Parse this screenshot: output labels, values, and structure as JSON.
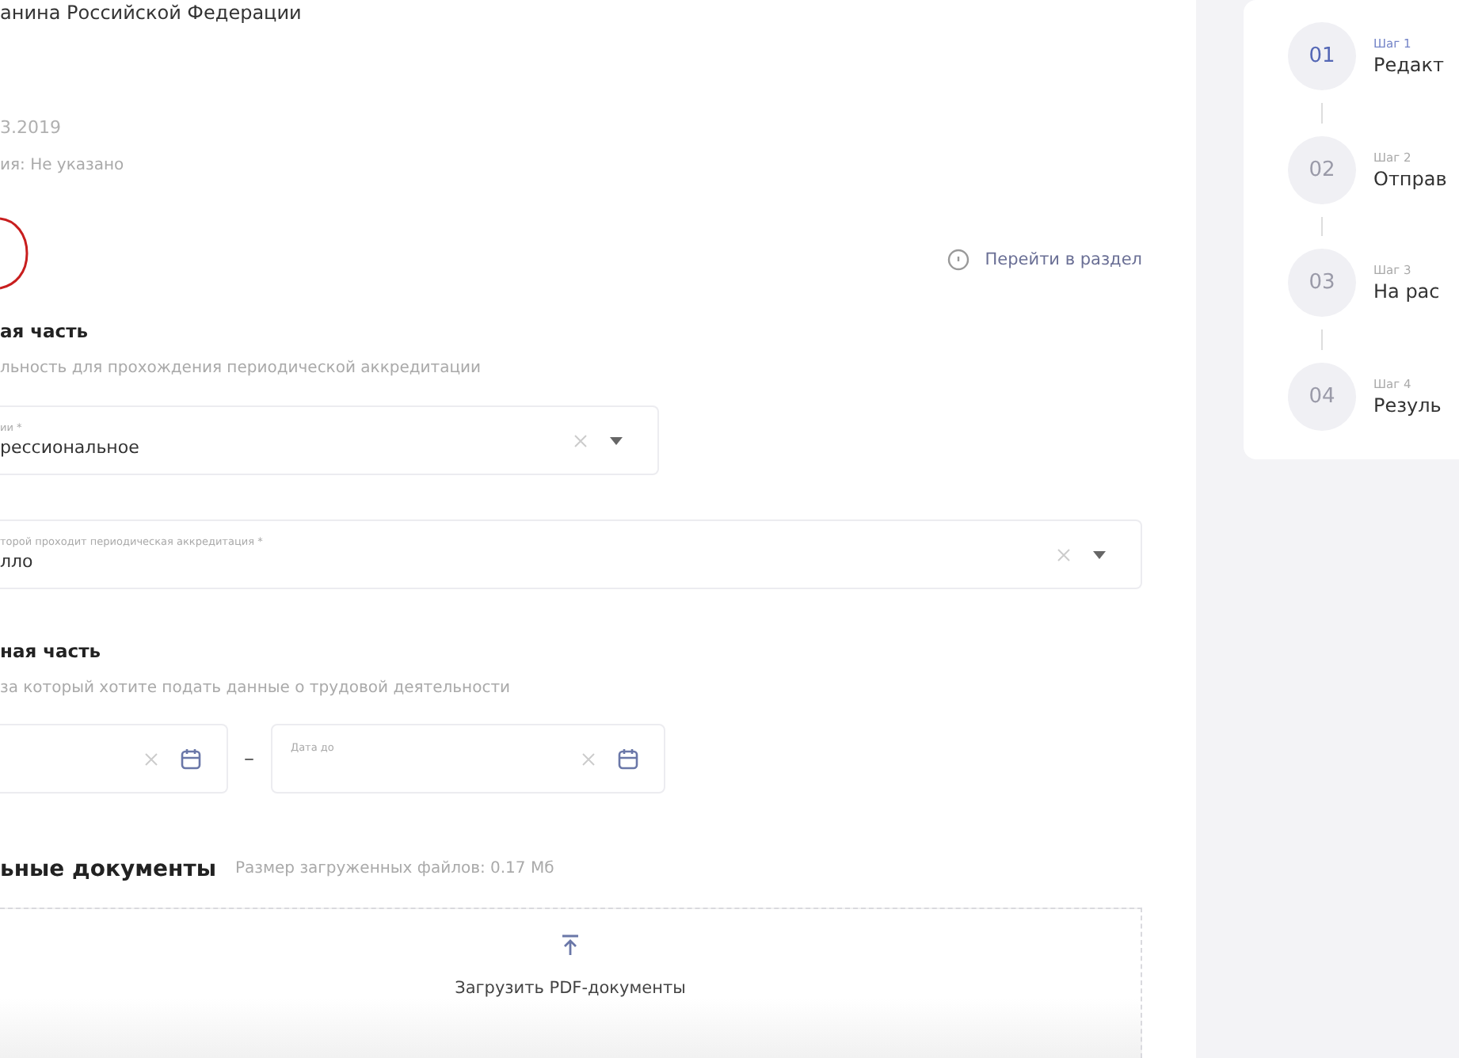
{
  "header": {
    "title": "анина Российской Федерации",
    "date": "3.2019",
    "note": "ия: Не указано"
  },
  "section_link": {
    "label": "Перейти в раздел"
  },
  "main_part": {
    "title": "ая часть",
    "subtitle": "льность для прохождения периодической аккредитации",
    "fields": [
      {
        "label": "ии *",
        "value": "рессиональное",
        "wide": false
      },
      {
        "label": "торой проходит периодическая аккредитация *",
        "value": "лло",
        "wide": true
      }
    ]
  },
  "period_part": {
    "title": "ная часть",
    "subtitle": "за который хотите подать данные о трудовой деятельности",
    "separator": "–",
    "date_to": {
      "label": "Дата до"
    }
  },
  "documents": {
    "title": "ьные документы",
    "size_note": "Размер загруженных файлов: 0.17 Мб",
    "upload_label": "Загрузить PDF-документы"
  },
  "steps": [
    {
      "number": "01",
      "caption": "Шаг 1",
      "title": "Редакт",
      "selected": true
    },
    {
      "number": "02",
      "caption": "Шаг 2",
      "title": "Отправ",
      "selected": false
    },
    {
      "number": "03",
      "caption": "Шаг 3",
      "title": "На рас",
      "selected": false
    },
    {
      "number": "04",
      "caption": "Шаг 4",
      "title": "Резуль",
      "selected": false
    }
  ]
}
